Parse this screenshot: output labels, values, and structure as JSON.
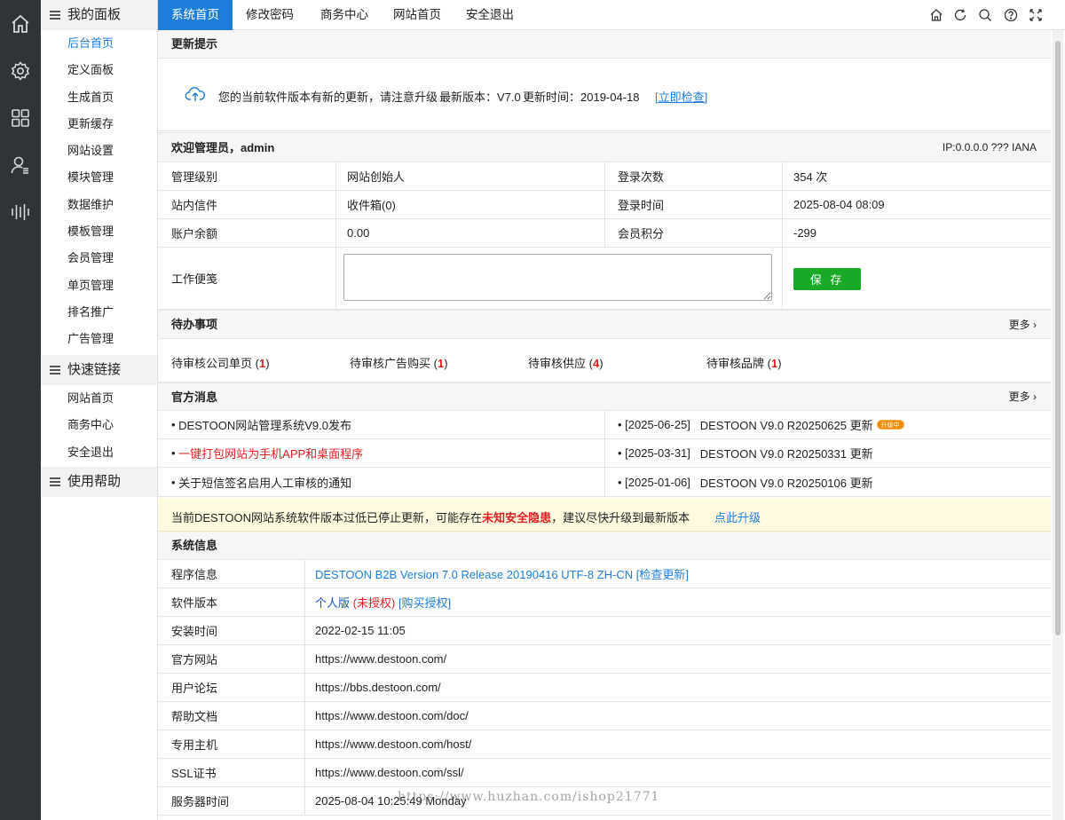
{
  "rail": {
    "icons": [
      "home-icon",
      "gear-icon",
      "grid-icon",
      "user-list-icon",
      "bars-icon"
    ]
  },
  "menu": {
    "groups": [
      {
        "label": "我的面板",
        "items": [
          "后台首页",
          "定义面板",
          "生成首页",
          "更新缓存",
          "网站设置",
          "模块管理",
          "数据维护",
          "模板管理",
          "会员管理",
          "单页管理",
          "排名推广",
          "广告管理"
        ]
      },
      {
        "label": "快速链接",
        "items": [
          "网站首页",
          "商务中心",
          "安全退出"
        ]
      },
      {
        "label": "使用帮助",
        "items": []
      }
    ]
  },
  "topbar": {
    "tabs": [
      "系统首页",
      "修改密码",
      "商务中心",
      "网站首页",
      "安全退出"
    ],
    "tools": [
      "home-icon",
      "refresh-icon",
      "search-icon",
      "help-icon",
      "fullscreen-icon"
    ]
  },
  "update": {
    "title": "更新提示",
    "message": "您的当前软件版本有新的更新，请注意升级",
    "latest": "最新版本：V7.0",
    "time": "更新时间：2019-04-18",
    "link": "[立即检查]"
  },
  "welcome": {
    "title": "欢迎管理员，admin",
    "ip": "IP:0.0.0.0 ??? IANA",
    "rows": [
      [
        "管理级别",
        "网站创始人",
        "登录次数",
        "354 次"
      ],
      [
        "站内信件",
        "收件箱(0)",
        "登录时间",
        "2025-08-04 08:09"
      ],
      [
        "账户余额",
        "0.00",
        "会员积分",
        "-299"
      ]
    ],
    "memo_label": "工作便笺",
    "save_label": "保 存"
  },
  "todo": {
    "title": "待办事项",
    "more": "更多",
    "items": [
      {
        "label": "待审核公司单页",
        "count": "1"
      },
      {
        "label": "待审核广告购买",
        "count": "1"
      },
      {
        "label": "待审核供应",
        "count": "4"
      },
      {
        "label": "待审核品牌",
        "count": "1"
      }
    ]
  },
  "news": {
    "title": "官方消息",
    "more": "更多",
    "left": [
      {
        "text": "DESTOON网站管理系统V9.0发布",
        "red": false
      },
      {
        "text": "一键打包网站为手机APP和桌面程序",
        "red": true
      },
      {
        "text": "关于短信签名启用人工审核的通知",
        "red": false
      }
    ],
    "right": [
      {
        "date": "[2025-06-25]",
        "text": "DESTOON V9.0 R20250625 更新",
        "badge": "升级中"
      },
      {
        "date": "[2025-03-31]",
        "text": "DESTOON V9.0 R20250331 更新",
        "badge": ""
      },
      {
        "date": "[2025-01-06]",
        "text": "DESTOON V9.0 R20250106 更新",
        "badge": ""
      }
    ]
  },
  "notice": {
    "before": "当前DESTOON网站系统软件版本过低已停止更新，可能存在",
    "highlight": "未知安全隐患",
    "after": "，建议尽快升级到最新版本",
    "link": "点此升级"
  },
  "sysinfo": {
    "title": "系统信息",
    "program_label": "程序信息",
    "program_value": "DESTOON B2B Version 7.0 Release 20190416 UTF-8 ZH-CN [检查更新]",
    "version_label": "软件版本",
    "version_personal": "个人版",
    "version_unauth": "(未授权)",
    "version_buy": "[购买授权]",
    "rows": [
      [
        "安装时间",
        "2022-02-15 11:05"
      ],
      [
        "官方网站",
        "https://www.destoon.com/"
      ],
      [
        "用户论坛",
        "https://bbs.destoon.com/"
      ],
      [
        "帮助文档",
        "https://www.destoon.com/doc/"
      ],
      [
        "专用主机",
        "https://www.destoon.com/host/"
      ],
      [
        "SSL证书",
        "https://www.destoon.com/ssl/"
      ],
      [
        "服务器时间",
        "2025-08-04 10:25:49 Monday"
      ]
    ]
  },
  "watermark": "https://www.huzhan.com/ishop21771"
}
